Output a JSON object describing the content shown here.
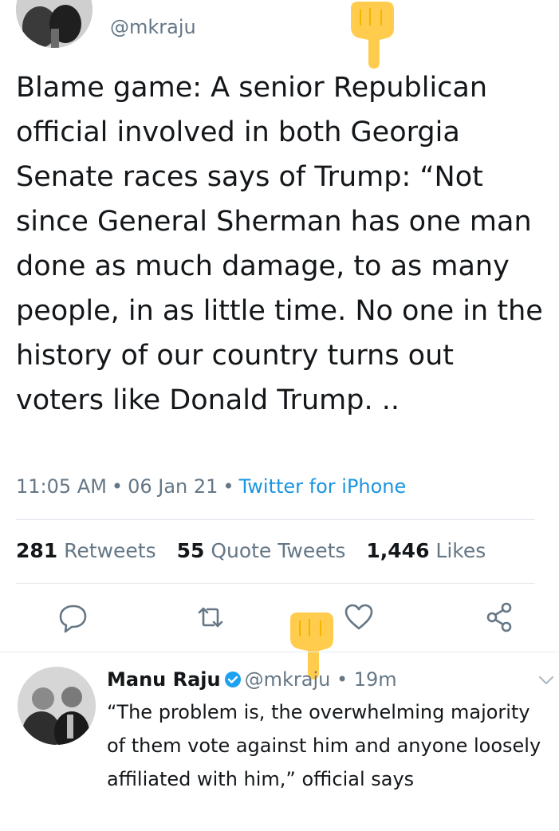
{
  "tweet": {
    "handle": "@mkraju",
    "text": "Blame game: A senior Republican official involved in both Georgia Senate races says of Trump: “Not since General Sherman has one man done as much damage, to as many people, in as little time. No one in the history of our country turns out voters like Donald Trump. ..",
    "time": "11:05 AM",
    "date": "06 Jan 21",
    "source": "Twitter for iPhone",
    "separator": "•"
  },
  "stats": {
    "retweets_count": "281",
    "retweets_label": "Retweets",
    "quotes_count": "55",
    "quotes_label": "Quote Tweets",
    "likes_count": "1,446",
    "likes_label": "Likes"
  },
  "actions": {
    "reply_icon": "reply-icon",
    "retweet_icon": "retweet-icon",
    "like_icon": "heart-icon",
    "share_icon": "share-icon"
  },
  "reply": {
    "name": "Manu Raju",
    "handle": "@mkraju",
    "dot": "•",
    "time": "19m",
    "text": "“The problem is, the overwhelming majority of them vote against him and anyone loosely affiliated with him,” official says",
    "verified_icon": "verified-badge-icon"
  },
  "colors": {
    "text": "#14171a",
    "secondary": "#657786",
    "link": "#1b95e0",
    "divider": "#e1e8ed",
    "verified": "#1da1f2",
    "emoji": "#ffcc4d"
  }
}
